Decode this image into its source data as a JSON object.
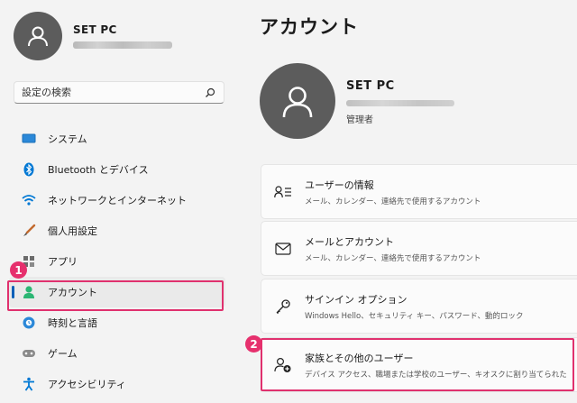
{
  "profile": {
    "name": "SET PC"
  },
  "search": {
    "placeholder": "設定の検索"
  },
  "nav": {
    "items": [
      {
        "label": "システム"
      },
      {
        "label": "Bluetooth とデバイス"
      },
      {
        "label": "ネットワークとインターネット"
      },
      {
        "label": "個人用設定"
      },
      {
        "label": "アプリ"
      },
      {
        "label": "アカウント",
        "selected": true
      },
      {
        "label": "時刻と言語"
      },
      {
        "label": "ゲーム"
      },
      {
        "label": "アクセシビリティ"
      }
    ]
  },
  "badges": {
    "one": "1",
    "two": "2"
  },
  "main": {
    "title": "アカウント",
    "account_name": "SET PC",
    "account_role": "管理者",
    "cards": [
      {
        "title": "ユーザーの情報",
        "desc": "メール、カレンダー、連絡先で使用するアカウント"
      },
      {
        "title": "メールとアカウント",
        "desc": "メール、カレンダー、連絡先で使用するアカウント"
      },
      {
        "title": "サインイン オプション",
        "desc": "Windows Hello、セキュリティ キー、パスワード、動的ロック"
      },
      {
        "title": "家族とその他のユーザー",
        "desc": "デバイス アクセス、職場または学校のユーザー、キオスクに割り当てられた"
      }
    ]
  },
  "colors": {
    "accent": "#005fb8",
    "highlight": "#e0316e",
    "avatar": "#5c5c5c"
  }
}
